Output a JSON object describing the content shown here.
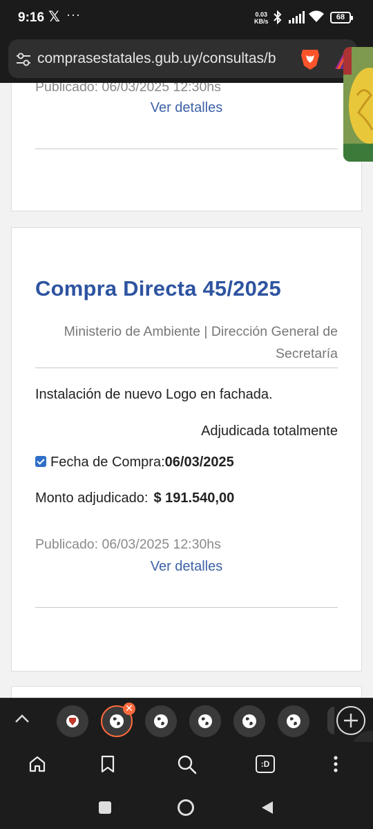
{
  "status_bar": {
    "time": "9:16",
    "x_icon": "x-logo-icon",
    "more": "···",
    "speed_value": "0.03",
    "speed_unit": "KB/s",
    "battery": "68"
  },
  "browser": {
    "url": "comprasestatales.gub.uy/consultas/b",
    "icons": [
      "tune-icon",
      "brave-shield-icon",
      "brave-rewards-icon"
    ]
  },
  "prev_card": {
    "published": "Publicado: 06/03/2025 12:30hs",
    "details_link": "Ver detalles"
  },
  "card": {
    "title": "Compra Directa 45/2025",
    "org": "Ministerio de Ambiente | Dirección General de Secretaría",
    "description": "Instalación de nuevo Logo en fachada.",
    "status": "Adjudicada totalmente",
    "date_label": "Fecha de Compra:",
    "date_value": "06/03/2025",
    "amount_label": "Monto adjudicado:",
    "amount_value": "$ 191.540,00",
    "published": "Publicado: 06/03/2025 12:30hs",
    "details_link": "Ver detalles"
  },
  "tabs": {
    "close_symbol": "✕",
    "count_visible": 7
  },
  "toolbar": {
    "items": [
      "home-icon",
      "bookmark-icon",
      "search-icon",
      "tabs-icon",
      "more-vert-icon"
    ],
    "tabs_label": ":D"
  },
  "colors": {
    "link": "#3d61a6",
    "title": "#2e54a0",
    "accent": "#ff6a3d",
    "checkbox": "#2f6fc7"
  }
}
